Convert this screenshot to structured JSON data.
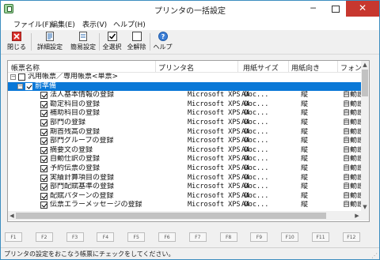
{
  "window": {
    "title": "プリンタの一括設定",
    "minimize": "─",
    "close": "✕"
  },
  "menu": [
    "ファイル(F)",
    "編集(E)",
    "表示(V)",
    "ヘルプ(H)"
  ],
  "toolbar": {
    "close": "閉じる",
    "detail": "詳細設定",
    "simple": "簡易設定",
    "select_all": "全選択",
    "deselect_all": "全解除",
    "help": "ヘルプ"
  },
  "list": {
    "columns": [
      "帳票名称",
      "プリンタ名",
      "用紙サイズ",
      "用紙向き",
      "フォン"
    ],
    "rows": [
      {
        "name": "汎用帳票／専用帳票<単票>",
        "printer": "",
        "size": "",
        "orient": "",
        "font": "",
        "checked": false,
        "expander": "−",
        "level": 0,
        "selected": false
      },
      {
        "name": "前準備",
        "printer": "",
        "size": "",
        "orient": "",
        "font": "",
        "checked": true,
        "expander": "−",
        "level": 1,
        "selected": true
      },
      {
        "name": "法人基本情報の登録",
        "printer": "Microsoft XPS Doc...",
        "size": "A4",
        "orient": "縦",
        "font": "自動設",
        "checked": true,
        "level": 2,
        "selected": false
      },
      {
        "name": "勘定科目の登録",
        "printer": "Microsoft XPS Doc...",
        "size": "A4",
        "orient": "縦",
        "font": "自動設",
        "checked": true,
        "level": 2,
        "selected": false
      },
      {
        "name": "補助科目の登録",
        "printer": "Microsoft XPS Doc...",
        "size": "A4",
        "orient": "縦",
        "font": "自動設",
        "checked": true,
        "level": 2,
        "selected": false
      },
      {
        "name": "部門の登録",
        "printer": "Microsoft XPS Doc...",
        "size": "A4",
        "orient": "縦",
        "font": "自動設",
        "checked": true,
        "level": 2,
        "selected": false
      },
      {
        "name": "期首残高の登録",
        "printer": "Microsoft XPS Doc...",
        "size": "A4",
        "orient": "縦",
        "font": "自動設",
        "checked": true,
        "level": 2,
        "selected": false
      },
      {
        "name": "部門グループの登録",
        "printer": "Microsoft XPS Doc...",
        "size": "A4",
        "orient": "縦",
        "font": "自動設",
        "checked": true,
        "level": 2,
        "selected": false
      },
      {
        "name": "摘要文の登録",
        "printer": "Microsoft XPS Doc...",
        "size": "A4",
        "orient": "縦",
        "font": "自動設",
        "checked": true,
        "level": 2,
        "selected": false
      },
      {
        "name": "自動仕訳の登録",
        "printer": "Microsoft XPS Doc...",
        "size": "A4",
        "orient": "縦",
        "font": "自動設",
        "checked": true,
        "level": 2,
        "selected": false
      },
      {
        "name": "予約伝票の登録",
        "printer": "Microsoft XPS Doc...",
        "size": "A4",
        "orient": "縦",
        "font": "自動設",
        "checked": true,
        "level": 2,
        "selected": false
      },
      {
        "name": "実績計算項目の登録",
        "printer": "Microsoft XPS Doc...",
        "size": "A4",
        "orient": "縦",
        "font": "自動設",
        "checked": true,
        "level": 2,
        "selected": false
      },
      {
        "name": "部門配賦基準の登録",
        "printer": "Microsoft XPS Doc...",
        "size": "A4",
        "orient": "縦",
        "font": "自動設",
        "checked": true,
        "level": 2,
        "selected": false
      },
      {
        "name": "配賦パターンの登録",
        "printer": "Microsoft XPS Doc...",
        "size": "A4",
        "orient": "縦",
        "font": "自動設",
        "checked": true,
        "level": 2,
        "selected": false
      },
      {
        "name": "伝票エラーメッセージの登録",
        "printer": "Microsoft XPS Doc...",
        "size": "A4",
        "orient": "縦",
        "font": "自動設",
        "checked": true,
        "level": 2,
        "selected": false
      }
    ]
  },
  "fkeys": [
    "F1",
    "F2",
    "F3",
    "F4",
    "F5",
    "F6",
    "F7",
    "F8",
    "F9",
    "F10",
    "F11",
    "F12"
  ],
  "status": "プリンタの設定をおこなう帳票にチェックをしてください。",
  "colors": {
    "selection": "#0a78d7",
    "close_button": "#c7372f",
    "window_border": "#3c8dbf"
  }
}
